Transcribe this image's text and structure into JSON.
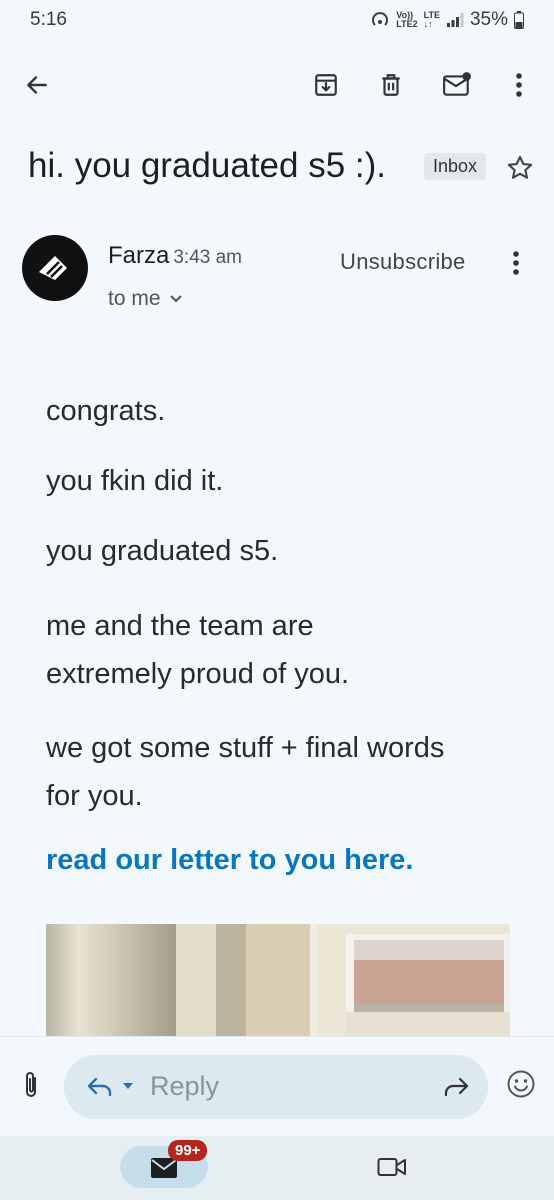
{
  "status_bar": {
    "time": "5:16",
    "volte": [
      "Vo))",
      "LTE2"
    ],
    "lte": [
      "LTE",
      "↓↑"
    ],
    "battery": "35%"
  },
  "toolbar": {
    "back_icon": "arrow-left-icon",
    "archive_icon": "archive-icon",
    "delete_icon": "trash-icon",
    "mark_unread_icon": "mail-unread-icon",
    "more_icon": "more-vertical-icon"
  },
  "email": {
    "subject": "hi. you graduated s5 :).",
    "label": "Inbox",
    "sender": "Farza",
    "time": "3:43 am",
    "to": "to me",
    "unsubscribe": "Unsubscribe",
    "body": [
      "congrats.",
      "you fkin did it.",
      "you graduated s5.",
      "me and the team are extremely proud of you.",
      "we got some stuff + final words for you."
    ],
    "link_text": "read our letter to you here."
  },
  "reply_bar": {
    "placeholder": "Reply"
  },
  "bottom_nav": {
    "mail_badge": "99+"
  },
  "colors": {
    "background": "#f2f8fb",
    "link": "#0b76c0",
    "badge": "#b3261e",
    "reply_pill": "#dce9f0"
  }
}
